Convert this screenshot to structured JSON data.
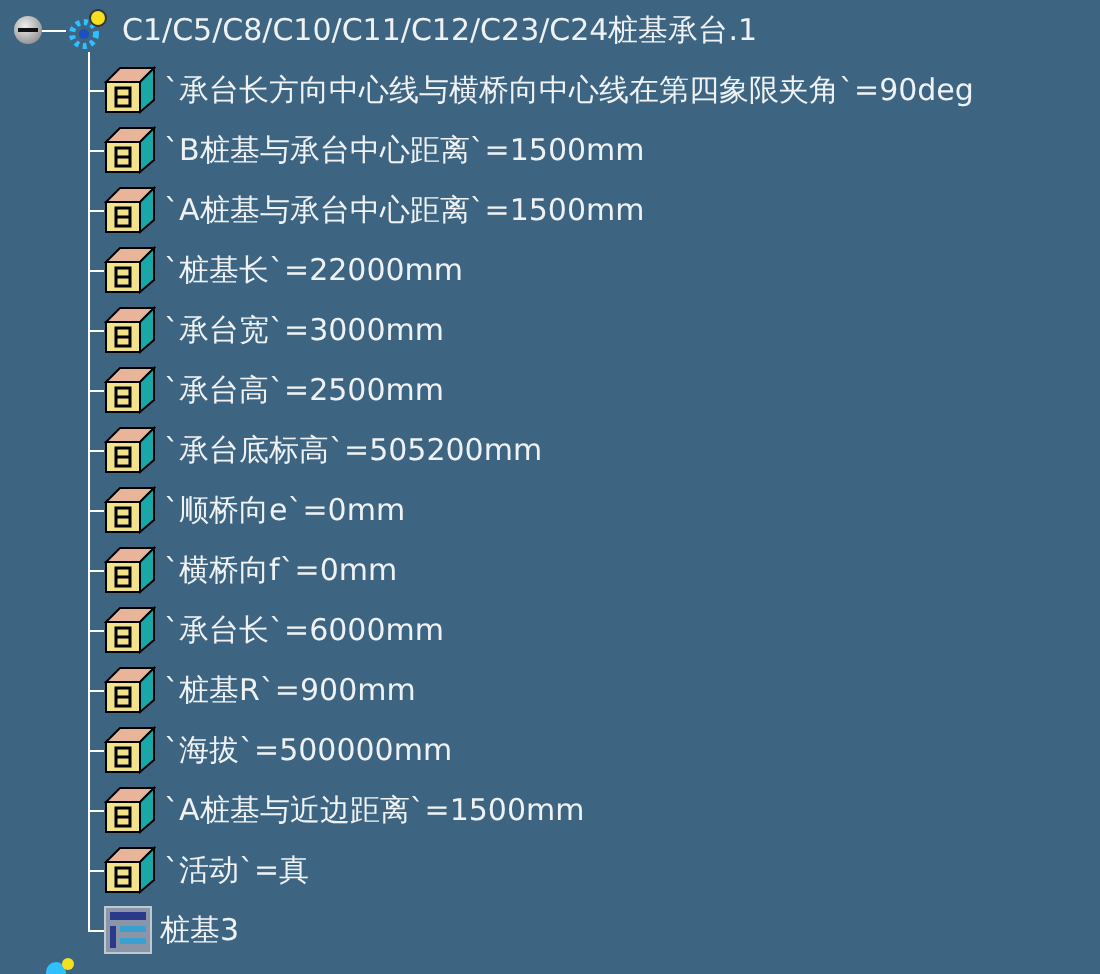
{
  "tree": {
    "label": "C1/C5/C8/C10/C11/C12/C23/C24桩基承台.1",
    "expanded": true,
    "children": [
      {
        "kind": "parameter",
        "label": "`承台长方向中心线与横桥向中心线在第四象限夹角`=90deg"
      },
      {
        "kind": "parameter",
        "label": "`B桩基与承台中心距离`=1500mm"
      },
      {
        "kind": "parameter",
        "label": "`A桩基与承台中心距离`=1500mm"
      },
      {
        "kind": "parameter",
        "label": "`桩基长`=22000mm"
      },
      {
        "kind": "parameter",
        "label": "`承台宽`=3000mm"
      },
      {
        "kind": "parameter",
        "label": "`承台高`=2500mm"
      },
      {
        "kind": "parameter",
        "label": "`承台底标高`=505200mm"
      },
      {
        "kind": "parameter",
        "label": "`顺桥向e`=0mm"
      },
      {
        "kind": "parameter",
        "label": "`横桥向f`=0mm"
      },
      {
        "kind": "parameter",
        "label": "`承台长`=6000mm"
      },
      {
        "kind": "parameter",
        "label": "`桩基R`=900mm"
      },
      {
        "kind": "parameter",
        "label": "`海拔`=500000mm"
      },
      {
        "kind": "parameter",
        "label": "`A桩基与近边距离`=1500mm"
      },
      {
        "kind": "parameter",
        "label": "`活动`=真"
      },
      {
        "kind": "sketch",
        "label": "桩基3"
      }
    ]
  }
}
